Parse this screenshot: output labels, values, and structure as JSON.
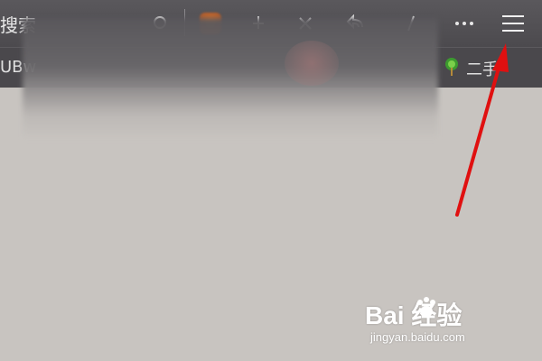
{
  "toolbar": {
    "search_text": "搜索",
    "icons": [
      "search-icon",
      "share-icon",
      "download-icon",
      "close-icon",
      "back-icon",
      "tools-icon",
      "more-icon",
      "menu-icon"
    ]
  },
  "bookmarks": {
    "left_text": "UBw",
    "item_label": "二手"
  },
  "watermark": {
    "brand": "Bai  经验",
    "url": "jingyan.baidu.com"
  },
  "colors": {
    "toolbar_bg": "#4c4a4e",
    "page_bg": "#c8c4c0",
    "annotation_arrow": "#e01010"
  }
}
